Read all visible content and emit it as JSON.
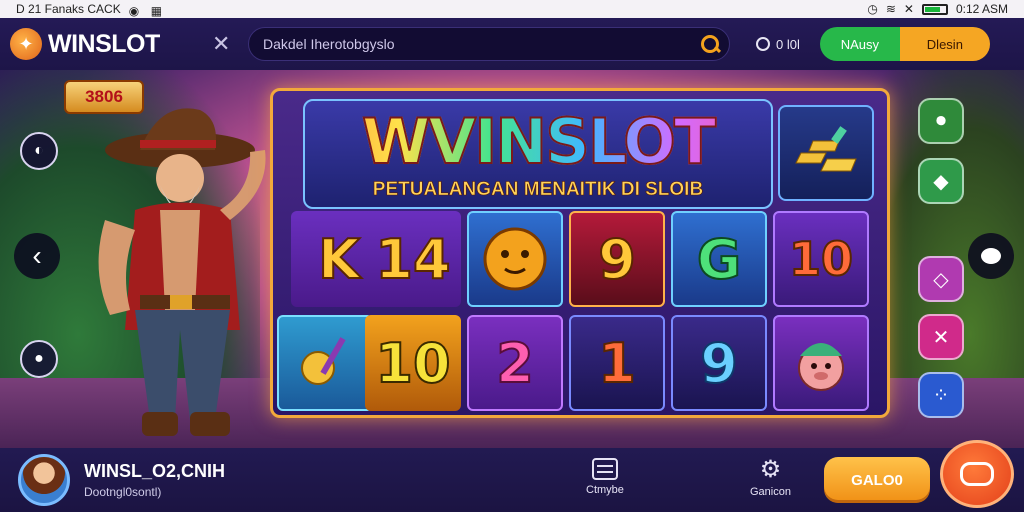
{
  "statusbar": {
    "left_text": "D 21  Fanaks CACK",
    "right_time": "0:12 ASM",
    "battery_level": 0.75
  },
  "header": {
    "logo_text": "WINSLOT",
    "search_placeholder": "Dakdel Iherotobgyslo",
    "online_text": "0 l0l",
    "login_label": "NAusy",
    "register_label": "Dlesin"
  },
  "scene": {
    "badge_value": "3806",
    "banner_title": "WVINSLOT",
    "banner_subtitle": "PETUALANGAN MENAITIK DI SLOIB",
    "grid_symbols": [
      "K",
      "14",
      "9",
      "G",
      "10",
      "10",
      "2",
      "1",
      "9"
    ]
  },
  "bottombar": {
    "user_name": "WINSL_O2,CNIH",
    "user_sub": "Dootngl0sontl)",
    "nav_menu_label": "Ctmybe",
    "nav_settings_label": "Ganicon",
    "cta_label": "GALO0"
  },
  "colors": {
    "accent_orange": "#f5a623",
    "login_green": "#27b84a",
    "header_bg": "#221a52"
  }
}
